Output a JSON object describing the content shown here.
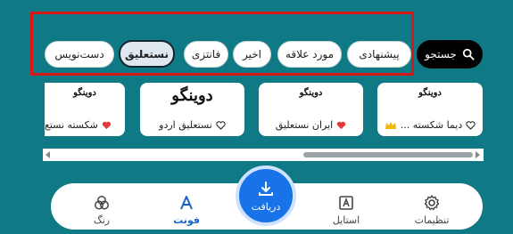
{
  "search": {
    "label": "جستجو"
  },
  "filters": [
    {
      "label": "پیشنهادی",
      "selected": false
    },
    {
      "label": "مورد علاقه",
      "selected": false
    },
    {
      "label": "اخیر",
      "selected": false
    },
    {
      "label": "فانتزی",
      "selected": false
    },
    {
      "label": "نستعلیق",
      "selected": true
    },
    {
      "label": "دست‌نویس",
      "selected": false
    }
  ],
  "cards": [
    {
      "sample": "دوینگو",
      "name": "دیما شکسته ...",
      "favorite": false,
      "premium": true
    },
    {
      "sample": "دوینگو",
      "name": "ایران نستعلیق",
      "favorite": true,
      "premium": false
    },
    {
      "sample": "دوینگو",
      "name": "نستعلیق اردو",
      "favorite": false,
      "premium": false
    },
    {
      "sample": "دوینگو",
      "name": "شکسته نستع",
      "favorite": true,
      "premium": false
    }
  ],
  "nav": {
    "settings": "تنظیمات",
    "style": "استایل",
    "download": "دریافت",
    "font": "فونت",
    "color": "رنگ"
  },
  "colors": {
    "background": "#0f7a85",
    "accent": "#1873e8",
    "heart": "#e53935",
    "crown": "#f2b705",
    "highlight_box": "#d91616"
  }
}
